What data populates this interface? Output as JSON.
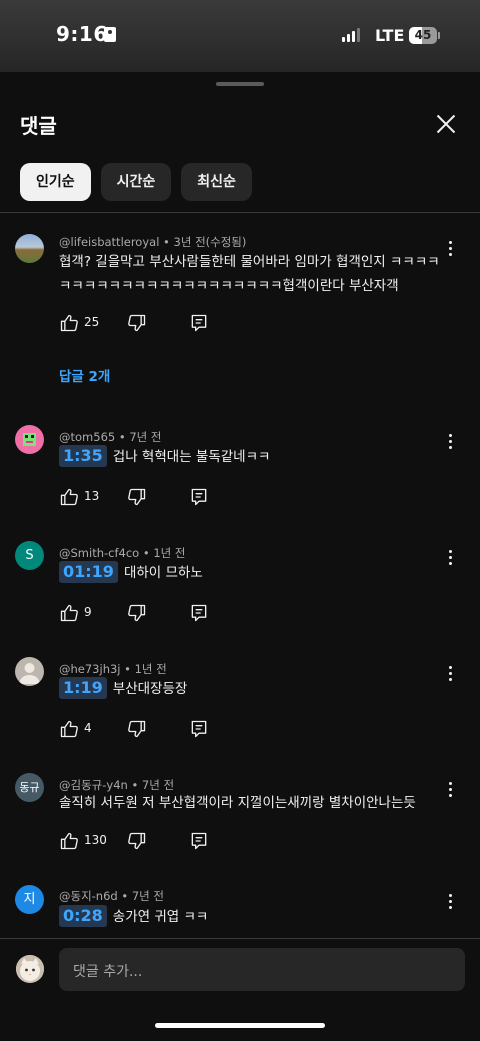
{
  "status": {
    "time": "9:16",
    "network": "LTE",
    "battery": "45",
    "battery_level": 0.45
  },
  "sheet": {
    "title": "댓글"
  },
  "chips": [
    {
      "label": "인기순",
      "active": true
    },
    {
      "label": "시간순",
      "active": false
    },
    {
      "label": "최신순",
      "active": false
    }
  ],
  "comments": [
    {
      "author": "@lifeisbattleroyal",
      "age": "3년 전(수정됨)",
      "text": "협객? 길을막고 부산사람들한테 물어바라 임마가 협객인지 ㅋㅋㅋㅋㅋㅋㅋㅋㅋㅋㅋㅋㅋㅋㅋㅋㅋㅋㅋㅋㅋㅋ협객이란다 부산자객",
      "likes": "25",
      "replies": "답글 2개",
      "avatar": "landscape"
    },
    {
      "author": "@tom565",
      "age": "7년 전",
      "timestamp": "1:35",
      "text": "겁나 혁혁대는 불독같네ㅋㅋ",
      "likes": "13",
      "avatar": "pink-pixel"
    },
    {
      "author": "@Smith-cf4co",
      "age": "1년 전",
      "timestamp": "01:19",
      "text": "대하이 므하노",
      "likes": "9",
      "avatar_letter": "S",
      "avatar_color": "#00897b"
    },
    {
      "author": "@he73jh3j",
      "age": "1년 전",
      "timestamp": "1:19",
      "text": "부산대장등장",
      "likes": "4",
      "avatar": "default-person"
    },
    {
      "author": "@김동규-y4n",
      "age": "7년 전",
      "text": "솔직히 서두원 저 부산협객이라 지껄이는새끼랑 별차이안나는듯",
      "likes": "130",
      "avatar_letter": "동규",
      "avatar_color": "#455a64"
    },
    {
      "author": "@동지-n6d",
      "age": "7년 전",
      "timestamp": "0:28",
      "text": "송가연 귀엽 ㅋㅋ",
      "avatar_letter": "지",
      "avatar_color": "#1e88e5"
    }
  ],
  "composer": {
    "placeholder": "댓글 추가..."
  },
  "icons": {
    "like": "thumbs-up-icon",
    "dislike": "thumbs-down-icon",
    "reply": "reply-icon",
    "more": "more-vertical-icon",
    "close": "close-icon"
  }
}
